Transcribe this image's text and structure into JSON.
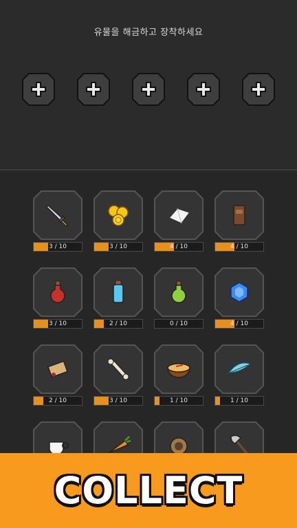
{
  "header": {
    "title": "유물을 해금하고 장착하세요"
  },
  "equip_slots": [
    {
      "icon": "plus-icon"
    },
    {
      "icon": "plus-icon"
    },
    {
      "icon": "plus-icon"
    },
    {
      "icon": "plus-icon"
    },
    {
      "icon": "plus-icon"
    }
  ],
  "relics": [
    {
      "icon": "sword-icon",
      "progress": "3 / 10",
      "value": 3,
      "max": 10
    },
    {
      "icon": "gold-coins-icon",
      "progress": "3 / 10",
      "value": 3,
      "max": 10
    },
    {
      "icon": "white-gem-icon",
      "progress": "4 / 10",
      "value": 4,
      "max": 10
    },
    {
      "icon": "wooden-plank-icon",
      "progress": "4 / 10",
      "value": 4,
      "max": 10
    },
    {
      "icon": "red-potion-icon",
      "progress": "3 / 10",
      "value": 3,
      "max": 10
    },
    {
      "icon": "blue-potion-icon",
      "progress": "2 / 10",
      "value": 2,
      "max": 10
    },
    {
      "icon": "green-potion-icon",
      "progress": "0 / 10",
      "value": 0,
      "max": 10
    },
    {
      "icon": "blue-gem-icon",
      "progress": "4 / 10",
      "value": 4,
      "max": 10
    },
    {
      "icon": "scroll-icon",
      "progress": "2 / 10",
      "value": 2,
      "max": 10
    },
    {
      "icon": "bone-icon",
      "progress": "3 / 10",
      "value": 3,
      "max": 10
    },
    {
      "icon": "soup-bowl-icon",
      "progress": "1 / 10",
      "value": 1,
      "max": 10
    },
    {
      "icon": "feather-icon",
      "progress": "1 / 10",
      "value": 1,
      "max": 10
    },
    {
      "icon": "tea-cup-icon"
    },
    {
      "icon": "carrot-icon"
    },
    {
      "icon": "ring-icon"
    },
    {
      "icon": "axe-icon"
    }
  ],
  "banner": {
    "text": "COLLECT"
  },
  "colors": {
    "accent": "#f79a1d",
    "progress": "#e8901c",
    "background": "#262626"
  }
}
